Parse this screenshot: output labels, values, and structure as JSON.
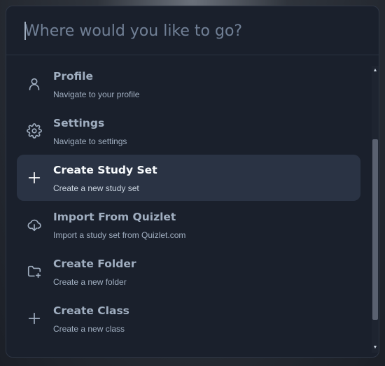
{
  "search": {
    "placeholder": "Where would you like to go?",
    "value": ""
  },
  "items": [
    {
      "title": "Profile",
      "description": "Navigate to your profile",
      "icon": "user-icon"
    },
    {
      "title": "Settings",
      "description": "Navigate to settings",
      "icon": "gear-icon"
    },
    {
      "title": "Create Study Set",
      "description": "Create a new study set",
      "icon": "plus-icon",
      "active": true
    },
    {
      "title": "Import From Quizlet",
      "description": "Import a study set from Quizlet.com",
      "icon": "cloud-download-icon"
    },
    {
      "title": "Create Folder",
      "description": "Create a new folder",
      "icon": "folder-plus-icon"
    },
    {
      "title": "Create Class",
      "description": "Create a new class",
      "icon": "plus-icon"
    }
  ],
  "colors": {
    "panel_bg": "#1a202c",
    "active_item_bg": "#2a3344",
    "text_muted": "#a0aec0",
    "text_active": "#f7fafc"
  }
}
